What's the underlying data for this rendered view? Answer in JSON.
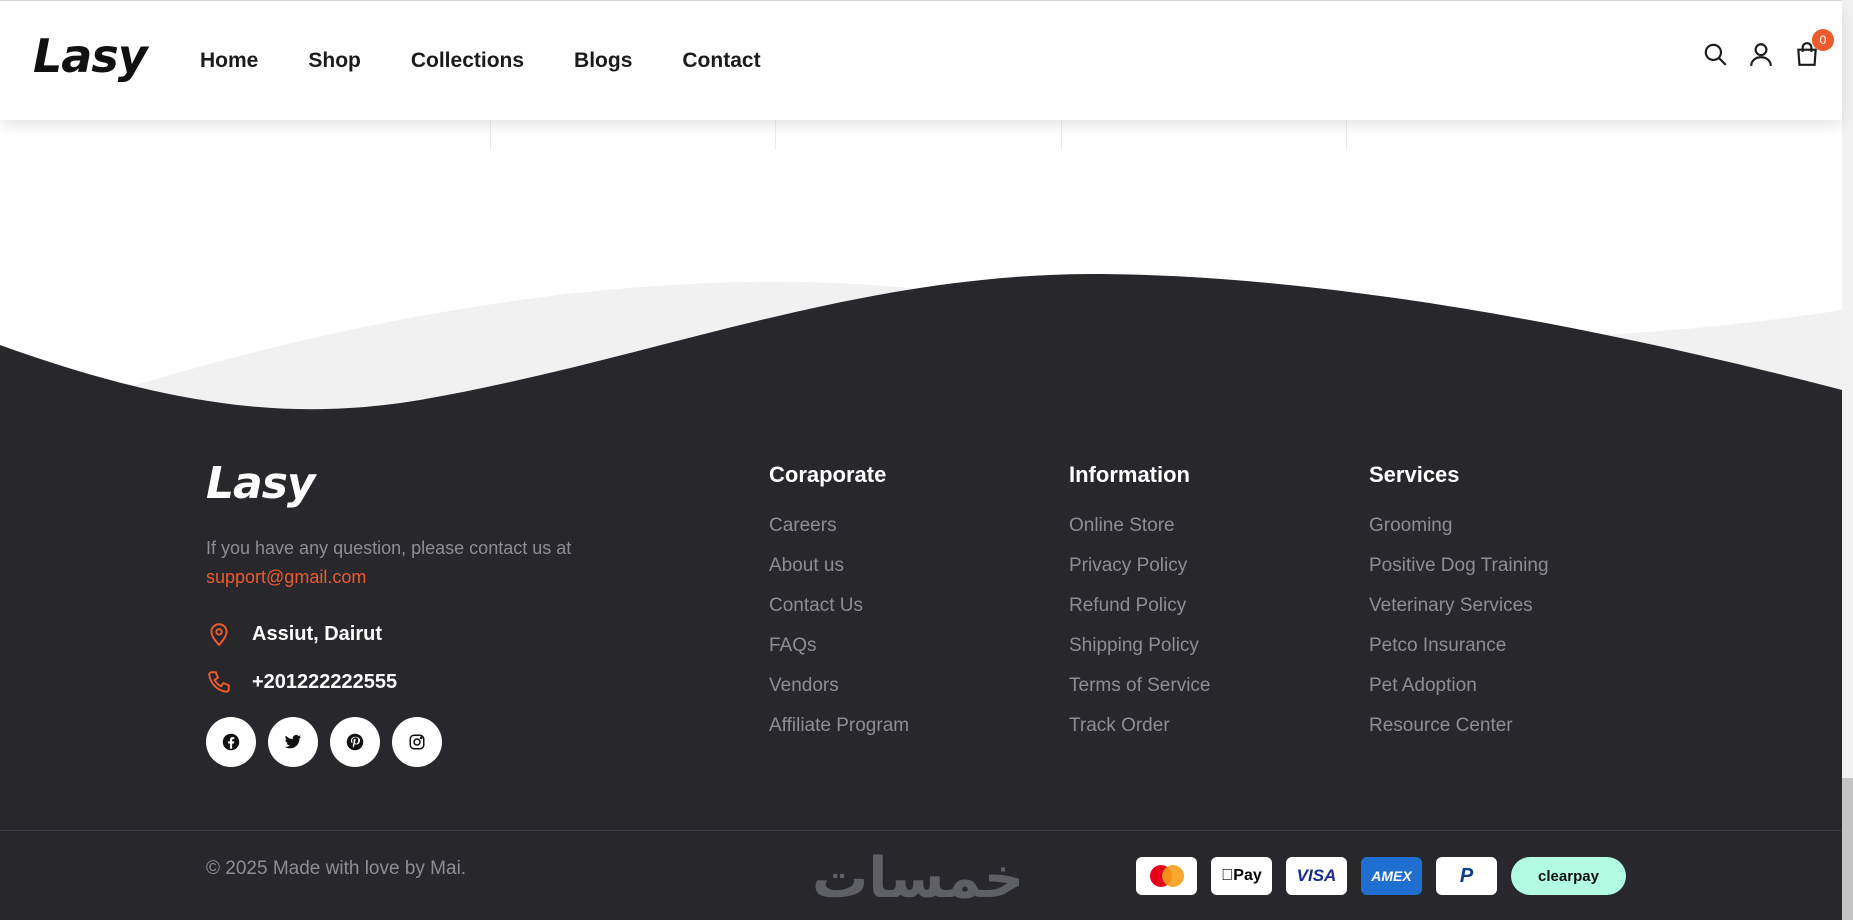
{
  "header": {
    "logo": "Lasy",
    "nav": [
      "Home",
      "Shop",
      "Collections",
      "Blogs",
      "Contact"
    ],
    "cart_count": "0",
    "icons": [
      "search-icon",
      "user-icon",
      "cart-icon"
    ]
  },
  "footer": {
    "logo": "Lasy",
    "contact_text": "If you have any question, please contact us at",
    "email": "support@gmail.com",
    "address": "Assiut, Dairut",
    "phone": "+201222222555",
    "social_icons": [
      "facebook-icon",
      "twitter-icon",
      "pinterest-icon",
      "instagram-icon"
    ],
    "columns": [
      {
        "title": "Coraporate",
        "links": [
          "Careers",
          "About us",
          "Contact Us",
          "FAQs",
          "Vendors",
          "Affiliate Program"
        ]
      },
      {
        "title": "Information",
        "links": [
          "Online Store",
          "Privacy Policy",
          "Refund Policy",
          "Shipping Policy",
          "Terms of Service",
          "Track Order"
        ]
      },
      {
        "title": "Services",
        "links": [
          "Grooming",
          "Positive Dog Training",
          "Veterinary Services",
          "Petco Insurance",
          "Pet Adoption",
          "Resource Center"
        ]
      }
    ],
    "copyright": "© 2025 Made with love by Mai.",
    "watermark": "خمسات",
    "payments": [
      "mastercard",
      "Pay",
      "VISA",
      "AMEX",
      "P",
      "clearpay"
    ]
  },
  "colors": {
    "accent": "#ec5b2e",
    "footer_bg": "#27272c",
    "muted_text": "#8d8d93"
  }
}
